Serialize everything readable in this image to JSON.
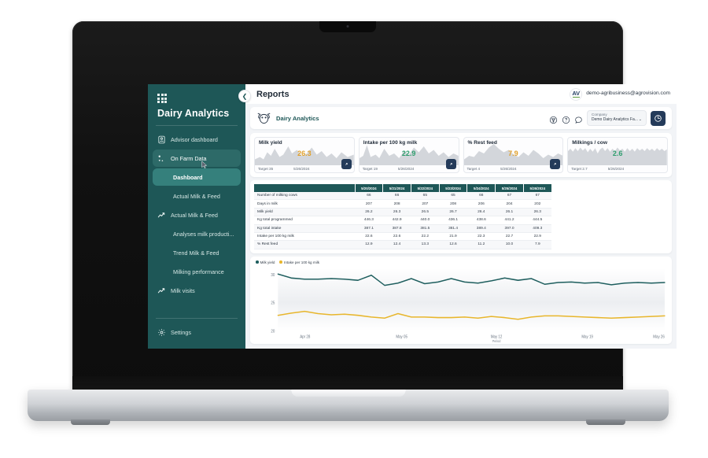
{
  "sidebar": {
    "brand": "Dairy Analytics",
    "grid_icon": "grid-icon",
    "items": [
      {
        "label": "Advisor dashboard",
        "icon": "advisor-icon",
        "state": "normal",
        "level": "top"
      },
      {
        "label": "On Farm Data",
        "icon": "data-points-icon",
        "state": "active",
        "level": "top"
      },
      {
        "label": "Dashboard",
        "icon": "",
        "state": "selected",
        "level": "sub"
      },
      {
        "label": "Actual Milk & Feed",
        "icon": "",
        "state": "normal",
        "level": "sub"
      },
      {
        "label": "Actual Milk & Feed",
        "icon": "trend-icon",
        "state": "normal",
        "level": "top"
      },
      {
        "label": "Analyses milk producti...",
        "icon": "",
        "state": "normal",
        "level": "sub"
      },
      {
        "label": "Trend Milk & Feed",
        "icon": "",
        "state": "normal",
        "level": "sub"
      },
      {
        "label": "Milking performance",
        "icon": "",
        "state": "normal",
        "level": "sub"
      },
      {
        "label": "Milk visits",
        "icon": "trend-icon",
        "state": "normal",
        "level": "top"
      }
    ],
    "settings": {
      "label": "Settings",
      "icon": "gear-icon"
    }
  },
  "header": {
    "title": "Reports",
    "back_icon": "chevron-left-icon",
    "account_email": "demo-agribusiness@agrovision.com",
    "logo_text": "AV"
  },
  "toolbar": {
    "icon": "cow-head-icon",
    "title": "Dairy Analytics",
    "icons": [
      "filter-icon",
      "help-icon",
      "chat-icon"
    ],
    "company": {
      "label": "Company",
      "value": "Demo Dairy Analytics Fa...",
      "chevron": "chevron-down-icon"
    },
    "clock_icon": "clock-report-icon"
  },
  "kpis": [
    {
      "title": "Milk yield",
      "value": "26.3",
      "tone": "warn",
      "target": "Target 35",
      "date": "5/26/2024",
      "has_edit": true,
      "edit_icon": "expand-icon"
    },
    {
      "title": "Intake per 100 kg milk",
      "value": "22.9",
      "tone": "ok",
      "target": "Target 19",
      "date": "5/26/2024",
      "has_edit": true,
      "edit_icon": "expand-icon"
    },
    {
      "title": "% Rest feed",
      "value": "7.9",
      "tone": "warn",
      "target": "Target 4",
      "date": "5/26/2024",
      "has_edit": true,
      "edit_icon": "expand-icon"
    },
    {
      "title": "Milkings / cow",
      "value": "2.6",
      "tone": "ok",
      "target": "Target 2.7",
      "date": "5/26/2024",
      "has_edit": false,
      "edit_icon": "expand-icon"
    }
  ],
  "table": {
    "corner_label": "",
    "columns": [
      "5/20/2024",
      "5/21/2024",
      "5/22/2024",
      "5/23/2024",
      "5/24/2024",
      "5/25/2024",
      "5/26/2024"
    ],
    "rows": [
      {
        "label": "Number of milking cows",
        "values": [
          "66",
          "66",
          "65",
          "65",
          "66",
          "67",
          "67"
        ]
      },
      {
        "label": "Days in milk",
        "values": [
          "207",
          "208",
          "207",
          "208",
          "206",
          "204",
          "202"
        ]
      },
      {
        "label": "Milk yield",
        "values": [
          "26.2",
          "26.3",
          "26.5",
          "26.7",
          "26.4",
          "26.1",
          "26.3"
        ]
      },
      {
        "label": "Kg total programmed",
        "values": [
          "446.3",
          "442.9",
          "440.0",
          "436.1",
          "438.6",
          "441.2",
          "444.5"
        ]
      },
      {
        "label": "Kg total intake",
        "values": [
          "387.1",
          "387.8",
          "381.5",
          "381.4",
          "389.4",
          "397.0",
          "409.3"
        ]
      },
      {
        "label": "Intake per 100 kg milk",
        "values": [
          "22.6",
          "22.6",
          "22.2",
          "21.9",
          "22.3",
          "22.7",
          "22.9"
        ]
      },
      {
        "label": "% Rest feed",
        "values": [
          "12.9",
          "12.4",
          "13.3",
          "12.6",
          "11.2",
          "10.0",
          "7.9"
        ]
      }
    ]
  },
  "chart_data": {
    "type": "line",
    "title": "",
    "xlabel": "Period",
    "ylabel": "",
    "ylim": [
      20,
      31
    ],
    "yticks": [
      20,
      25,
      30
    ],
    "grid": false,
    "legend_position": "top-left",
    "x_tick_labels": [
      "Apr 28",
      "May 05",
      "May 12",
      "May 19",
      "May 26"
    ],
    "x_tick_positions": [
      0.07,
      0.32,
      0.565,
      0.8,
      0.985
    ],
    "series": [
      {
        "name": "Milk yield",
        "color": "#1e5e5e",
        "values": [
          30.0,
          29.3,
          29.1,
          29.1,
          29.2,
          29.1,
          28.9,
          29.8,
          28.0,
          28.4,
          29.2,
          28.3,
          28.6,
          29.2,
          28.6,
          28.4,
          28.8,
          29.3,
          28.9,
          29.2,
          28.2,
          28.5,
          28.6,
          28.4,
          28.5,
          28.1,
          28.4,
          28.5,
          28.4,
          28.5
        ]
      },
      {
        "name": "Intake per 100 kg milk",
        "color": "#e8b62c",
        "values": [
          22.7,
          23.1,
          23.4,
          23.0,
          22.8,
          22.9,
          22.7,
          22.4,
          22.2,
          23.0,
          22.4,
          22.4,
          22.3,
          22.3,
          22.4,
          22.2,
          22.5,
          22.3,
          22.0,
          22.4,
          22.6,
          22.6,
          22.5,
          22.4,
          22.3,
          22.2,
          22.3,
          22.4,
          22.5,
          22.6
        ]
      }
    ]
  }
}
